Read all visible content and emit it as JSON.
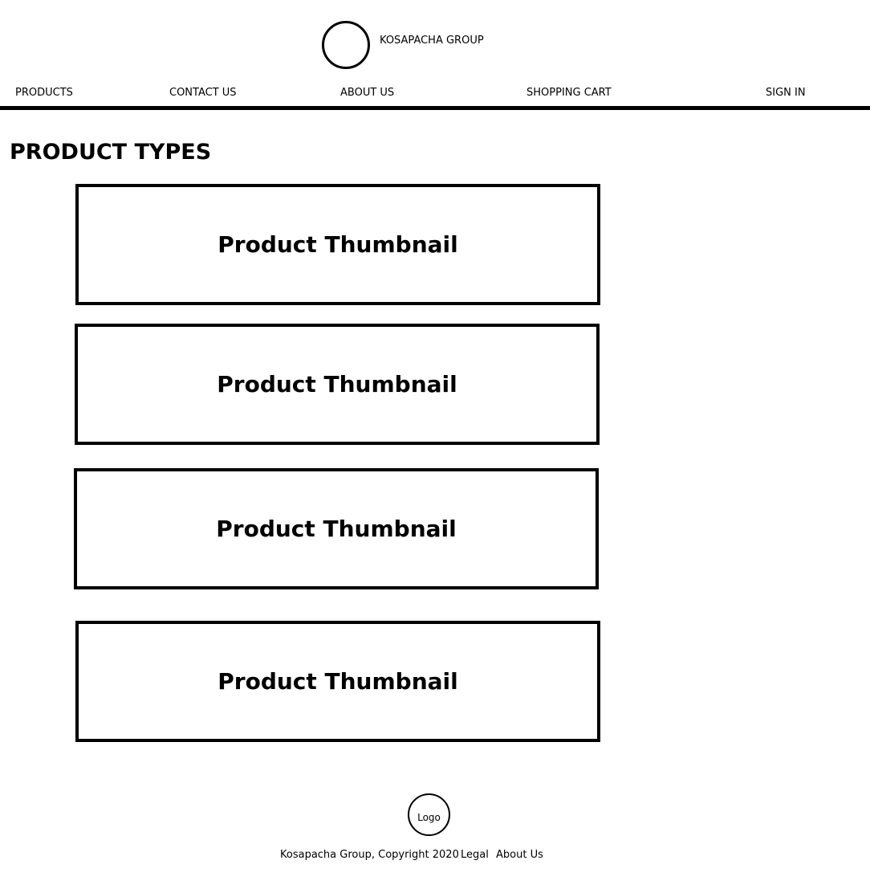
{
  "header": {
    "brand": "KOSAPACHA GROUP",
    "logo_icon": "circle-logo-icon"
  },
  "nav": {
    "products": "PRODUCTS",
    "contact_us": "CONTACT US",
    "about_us": "ABOUT US",
    "shopping_cart": "SHOPPING CART",
    "sign_in": "SIGN IN"
  },
  "main": {
    "title": "PRODUCT TYPES",
    "thumbnails": [
      {
        "label": "Product Thumbnail"
      },
      {
        "label": "Product Thumbnail"
      },
      {
        "label": "Product Thumbnail"
      },
      {
        "label": "Product Thumbnail"
      }
    ]
  },
  "footer": {
    "logo_label": "Logo",
    "copyright": "Kosapacha Group, Copyright 2020",
    "legal": "Legal",
    "about_us": "About Us"
  }
}
